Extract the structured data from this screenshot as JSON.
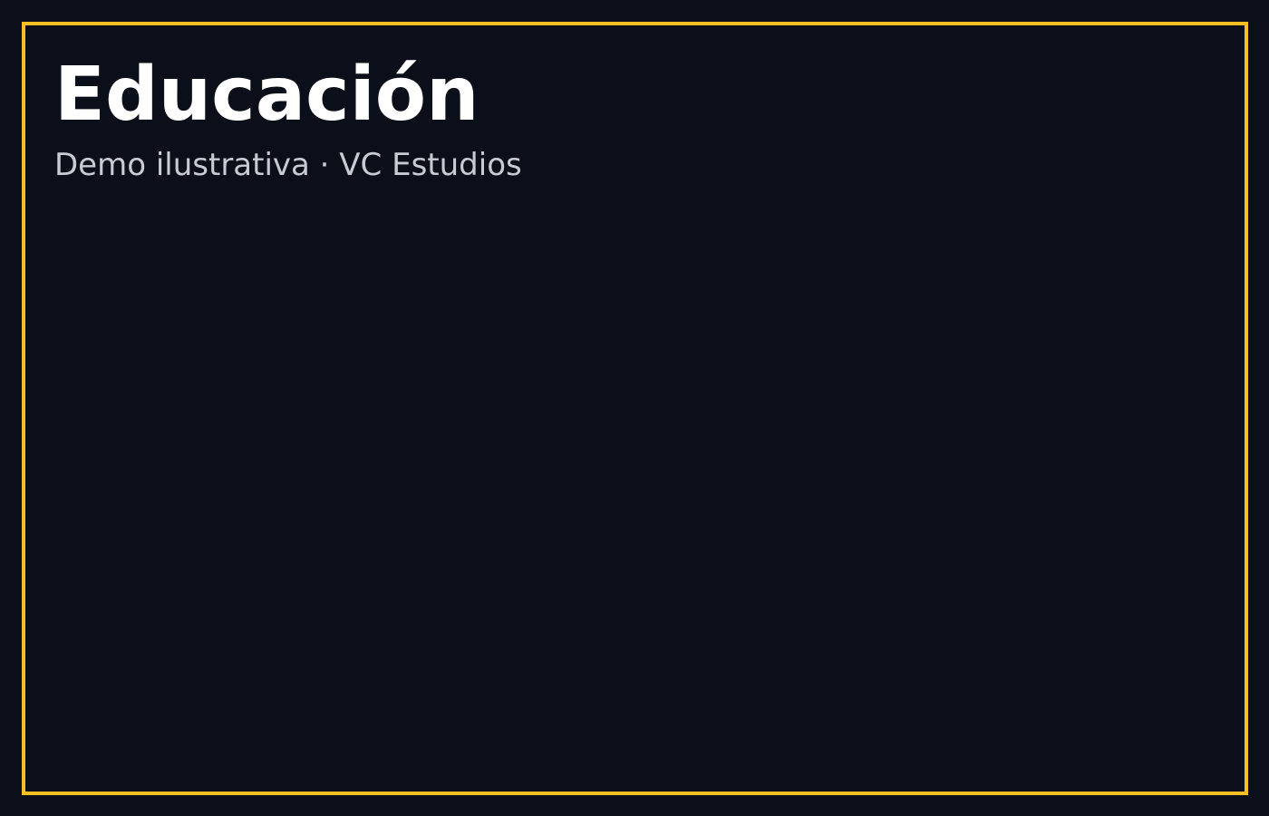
{
  "page": {
    "title": "Educación",
    "subtitle": "Demo ilustrativa · VC Estudios"
  },
  "colors": {
    "background": "#0b0f19",
    "border": "#fbbf24",
    "title": "#ffffff",
    "subtitle": "#c7ccd4"
  }
}
